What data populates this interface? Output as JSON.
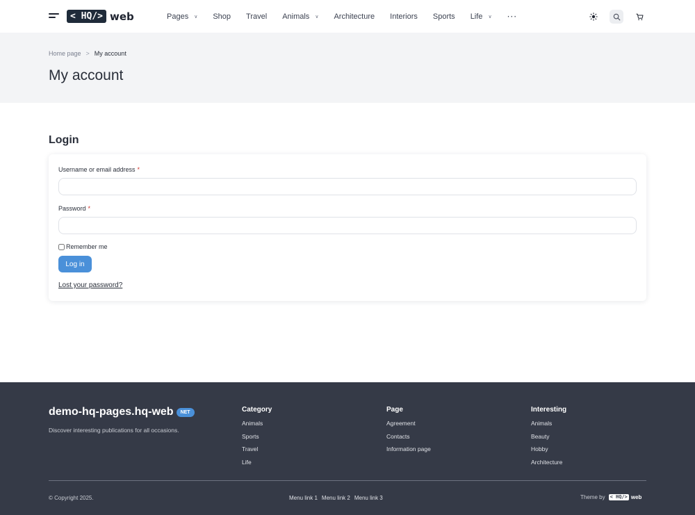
{
  "header": {
    "logo_box": "< HQ/>",
    "logo_text": "web",
    "nav": [
      {
        "label": "Pages",
        "has_dropdown": true
      },
      {
        "label": "Shop",
        "has_dropdown": false
      },
      {
        "label": "Travel",
        "has_dropdown": false
      },
      {
        "label": "Animals",
        "has_dropdown": true
      },
      {
        "label": "Architecture",
        "has_dropdown": false
      },
      {
        "label": "Interiors",
        "has_dropdown": false
      },
      {
        "label": "Sports",
        "has_dropdown": false
      },
      {
        "label": "Life",
        "has_dropdown": true
      }
    ],
    "more": "···",
    "icons": [
      "theme-toggle-icon",
      "search-icon",
      "cart-icon"
    ]
  },
  "hero": {
    "breadcrumb": {
      "home": "Home page",
      "separator": ">",
      "current": "My account"
    },
    "title": "My account"
  },
  "login": {
    "heading": "Login",
    "username_label": "Username or email address",
    "password_label": "Password",
    "required_mark": "*",
    "username_value": "",
    "password_value": "",
    "remember_label": "Remember me",
    "remember_checked": false,
    "button_label": "Log in",
    "lost_password": "Lost your password?"
  },
  "footer": {
    "site_name": "demo-hq-pages.hq-web",
    "badge": "NET",
    "tagline": "Discover interesting publications for all occasions.",
    "columns": [
      {
        "title": "Category",
        "items": [
          "Animals",
          "Sports",
          "Travel",
          "Life"
        ]
      },
      {
        "title": "Page",
        "items": [
          "Agreement",
          "Contacts",
          "Information page"
        ]
      },
      {
        "title": "Interesting",
        "items": [
          "Animals",
          "Beauty",
          "Hobby",
          "Architecture"
        ]
      }
    ],
    "copyright": "© Copyright 2025.",
    "bottom_links": [
      "Menu link 1",
      "Menu link 2",
      "Menu link 3"
    ],
    "theme_by": "Theme by",
    "theme_logo_box": "< HQ/>",
    "theme_logo_text": "web"
  },
  "colors": {
    "accent": "#4a90d9",
    "footer_bg": "#353a47",
    "hero_bg": "#f3f4f6",
    "logo_bg": "#1f2b3a",
    "required": "#d0342c"
  }
}
